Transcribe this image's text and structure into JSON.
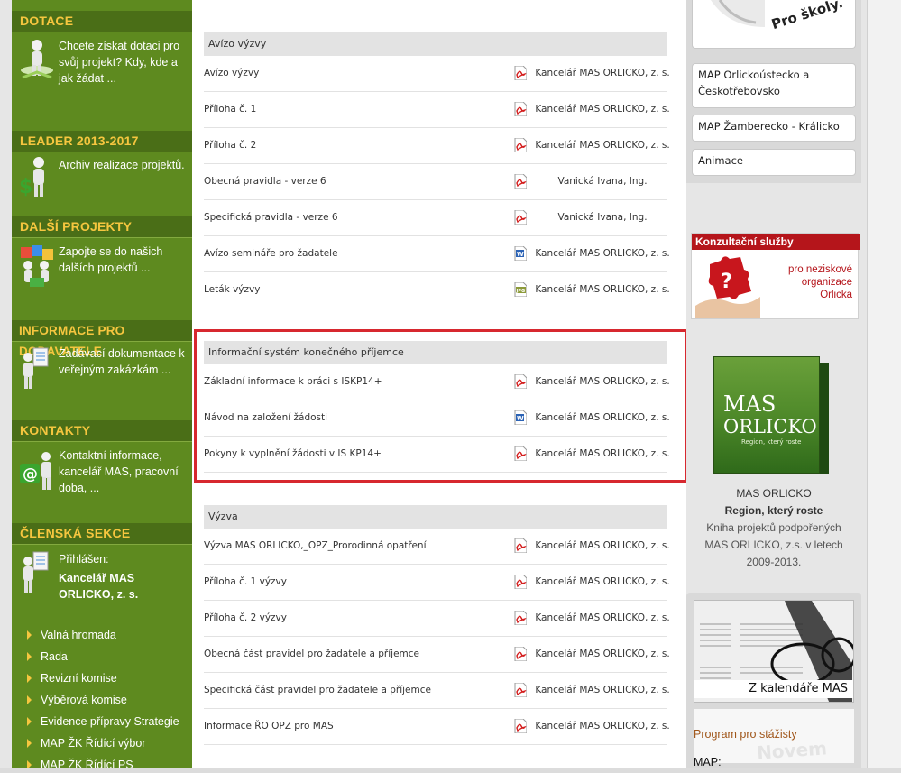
{
  "sidebar": {
    "dotace": {
      "title": "DOTACE",
      "text": "Chcete získat dotaci pro svůj projekt? Kdy, kde a jak žádat ..."
    },
    "leader": {
      "title": "LEADER 2013-2017",
      "text": "Archiv realizace projektů."
    },
    "dalsi": {
      "title": "DALŠÍ PROJEKTY",
      "text": "Zapojte se do našich dalších projektů ..."
    },
    "dodavatele": {
      "title": "INFORMACE PRO DODAVATELE",
      "text": "Zadávací dokumentace k veřejným zakázkám ..."
    },
    "kontakty": {
      "title": "KONTAKTY",
      "text": "Kontaktní informace, kancelář MAS, pracovní doba, ..."
    },
    "clenska": {
      "title": "ČLENSKÁ SEKCE",
      "login_label": "Přihlášen:",
      "user": "Kancelář MAS ORLICKO, z. s."
    },
    "menu": [
      "Valná hromada",
      "Rada",
      "Revizní komise",
      "Výběrová komise",
      "Evidence přípravy Strategie",
      "MAP ŽK Řídící výbor",
      "MAP ŽK Řídící PS"
    ]
  },
  "blocks": {
    "avizo": {
      "header": "Avízo výzvy",
      "rows": [
        {
          "name": "Avízo výzvy",
          "icon": "pdf-icon",
          "author": "Kancelář MAS ORLICKO, z. s."
        },
        {
          "name": "Příloha č. 1",
          "icon": "pdf-icon",
          "author": "Kancelář MAS ORLICKO, z. s."
        },
        {
          "name": "Příloha č. 2",
          "icon": "pdf-icon",
          "author": "Kancelář MAS ORLICKO, z. s."
        },
        {
          "name": "Obecná pravidla - verze 6",
          "icon": "pdf-icon",
          "author": "Vanická Ivana, Ing."
        },
        {
          "name": "Specifická pravidla - verze 6",
          "icon": "pdf-icon",
          "author": "Vanická Ivana, Ing."
        },
        {
          "name": "Avízo semináře pro žadatele",
          "icon": "word-icon",
          "author": "Kancelář MAS ORLICKO, z. s."
        },
        {
          "name": "Leták výzvy",
          "icon": "jpg-icon",
          "author": "Kancelář MAS ORLICKO, z. s."
        }
      ]
    },
    "iskp": {
      "header": "Informační systém konečného příjemce",
      "rows": [
        {
          "name": "Základní informace k práci s ISKP14+",
          "icon": "pdf-icon",
          "author": "Kancelář MAS ORLICKO, z. s."
        },
        {
          "name": "Návod na založení žádosti",
          "icon": "word-icon",
          "author": "Kancelář MAS ORLICKO, z. s."
        },
        {
          "name": "Pokyny k vyplnění žádosti v IS KP14+",
          "icon": "pdf-icon",
          "author": "Kancelář MAS ORLICKO, z. s."
        }
      ]
    },
    "vyzva": {
      "header": "Výzva",
      "rows": [
        {
          "name": "Výzva MAS ORLICKO,_OPZ_Prorodinná opatření",
          "icon": "pdf-icon",
          "author": "Kancelář MAS ORLICKO, z. s."
        },
        {
          "name": "Příloha č. 1 výzvy",
          "icon": "pdf-icon",
          "author": "Kancelář MAS ORLICKO, z. s."
        },
        {
          "name": "Příloha č. 2 výzvy",
          "icon": "pdf-icon",
          "author": "Kancelář MAS ORLICKO, z. s."
        },
        {
          "name": "Obecná část pravidel pro žadatele a příjemce",
          "icon": "pdf-icon",
          "author": "Kancelář MAS ORLICKO, z. s."
        },
        {
          "name": "Specifická část pravidel pro žadatele a příjemce",
          "icon": "pdf-icon",
          "author": "Kancelář MAS ORLICKO, z. s."
        },
        {
          "name": "Informace ŘO OPZ pro MAS",
          "icon": "pdf-icon",
          "author": "Kancelář MAS ORLICKO, z. s."
        }
      ]
    }
  },
  "right": {
    "pro_skoly": "Pro školy.",
    "links": [
      "MAP Orlickoústecko a Českotřebovsko",
      "MAP Žamberecko - Králicko",
      "Animace"
    ],
    "konzultace": {
      "title": "Konzultační služby",
      "text": "pro neziskové organizace Orlicka"
    },
    "book": {
      "cover_title_1": "MAS",
      "cover_title_2": "ORLICKO",
      "cover_sub": "Region, který roste",
      "title": "MAS ORLICKO",
      "subtitle": "Region, který roste",
      "desc": "Kniha projektů podpořených MAS ORLICKO, z.s. v letech 2009-2013."
    },
    "kalendar": "Z kalendáře MAS",
    "program": "Program pro stážisty",
    "map_label": "MAP:"
  }
}
